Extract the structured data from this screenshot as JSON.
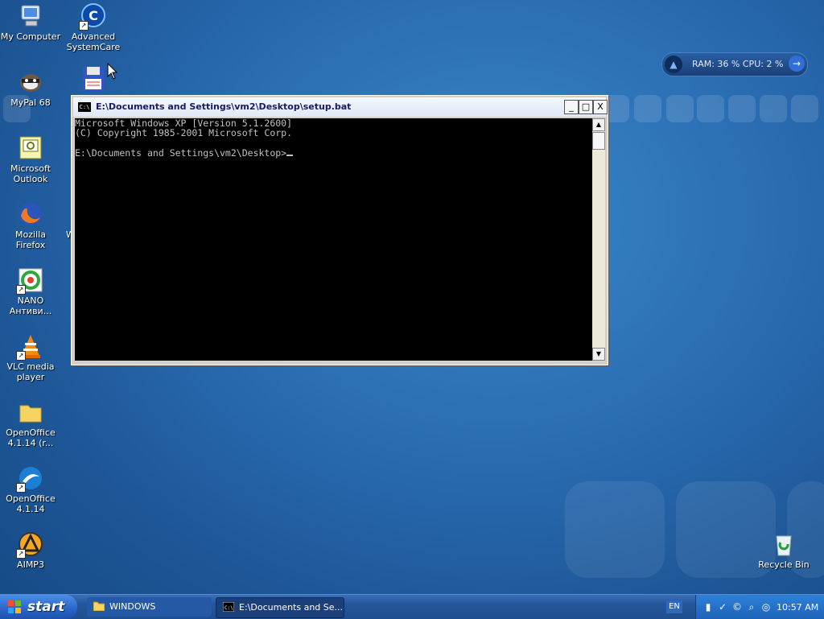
{
  "desktop": {
    "icons": [
      {
        "label": "My Computer",
        "icon": "computer-icon"
      },
      {
        "label": "Advanced SystemCare",
        "icon": "advanced-systemcare-icon"
      },
      {
        "label": "MyPal 68",
        "icon": "mypal-icon"
      },
      {
        "label": "Microsoft Outlook",
        "icon": "outlook-icon"
      },
      {
        "label": "Mozilla Firefox",
        "icon": "firefox-icon"
      },
      {
        "label": "NANO Антиви...",
        "icon": "nano-antivirus-icon"
      },
      {
        "label": "VLC media player",
        "icon": "vlc-icon"
      },
      {
        "label": "OpenOffice 4.1.14 (r...",
        "icon": "folder-icon"
      },
      {
        "label": "OpenOffice 4.1.14",
        "icon": "openoffice-icon"
      },
      {
        "label": "AIMP3",
        "icon": "aimp-icon"
      },
      {
        "label": "Recycle Bin",
        "icon": "recycle-bin-icon"
      }
    ],
    "partial_label": "W"
  },
  "gadget": {
    "ram_label": "RAM:",
    "ram_value": "36",
    "cpu_label": "CPU:",
    "cpu_value": "2",
    "unit": "%"
  },
  "console_window": {
    "title": "E:\\Documents and Settings\\vm2\\Desktop\\setup.bat",
    "lines": [
      "Microsoft Windows XP [Version 5.1.2600]",
      "(C) Copyright 1985-2001 Microsoft Corp.",
      "",
      "E:\\Documents and Settings\\vm2\\Desktop>"
    ],
    "icon_text": "C:\\",
    "minimize": "_",
    "maximize": "□",
    "close": "X"
  },
  "taskbar": {
    "start_label": "start",
    "tasks": [
      {
        "label": "WINDOWS",
        "icon": "folder-icon"
      },
      {
        "label": "E:\\Documents and Se...",
        "icon": "console-icon"
      }
    ],
    "language": "EN",
    "clock": "10:57 AM"
  },
  "colors": {
    "desktop": "#2a6db3",
    "taskbar": "#24559a",
    "start": "#2a64c8",
    "console_bg": "#000000",
    "console_fg": "#c0c0c0"
  }
}
